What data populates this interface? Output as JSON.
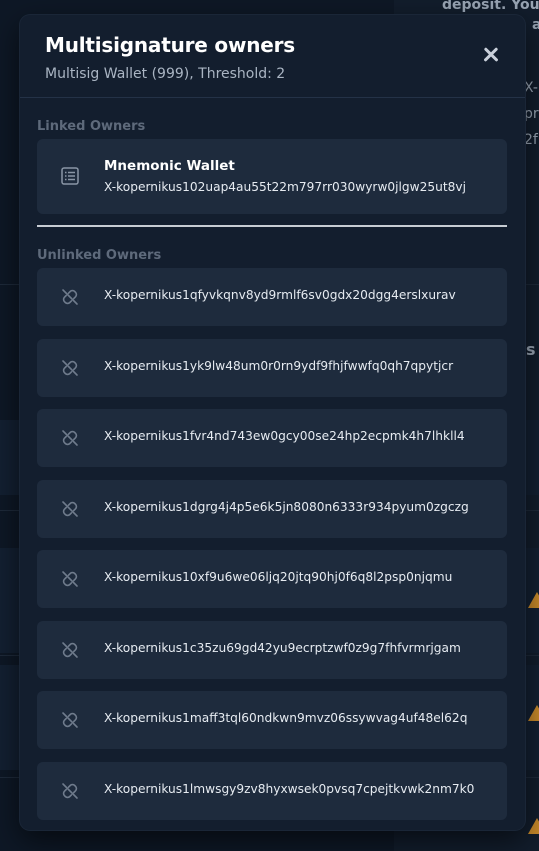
{
  "background": {
    "snippet_top_1": "deposit. You c",
    "snippet_top_2": "a",
    "snippet_right_1": "X-I",
    "snippet_right_2": "pr",
    "snippet_right_3": "2f",
    "snippet_right_4": "s"
  },
  "modal": {
    "title": "Multisignature owners",
    "subtitle": "Multisig Wallet (999), Threshold: 2",
    "close_icon": "close-x-icon"
  },
  "linked": {
    "section_label": "Linked Owners",
    "items": [
      {
        "icon": "wallet-list-icon",
        "name": "Mnemonic Wallet",
        "address": "X-kopernikus102uap4au55t22m797rr030wyrw0jlgw25ut8vj"
      }
    ]
  },
  "unlinked": {
    "section_label": "Unlinked Owners",
    "icon": "broken-link-icon",
    "items": [
      "X-kopernikus1qfyvkqnv8yd9rmlf6sv0gdx20dgg4erslxurav",
      "X-kopernikus1yk9lw48um0r0rn9ydf9fhjfwwfq0qh7qpytjcr",
      "X-kopernikus1fvr4nd743ew0gcy00se24hp2ecpmk4h7lhkll4",
      "X-kopernikus1dgrg4j4p5e6k5jn8080n6333r934pyum0zgczg",
      "X-kopernikus10xf9u6we06ljq20jtq90hj0f6q8l2psp0njqmu",
      "X-kopernikus1c35zu69gd42yu9ecrptzwf0z9g7fhfvrmrjgam",
      "X-kopernikus1maff3tql60ndkwn9mvz06ssywvag4uf48el62q",
      "X-kopernikus1lmwsgy9zv8hyxwsek0pvsq7cpejtkvwk2nm7k0"
    ]
  },
  "colors": {
    "modal_bg": "#131e2e",
    "card_bg": "#1e2b3d",
    "label_muted": "#5e6a7b",
    "warning": "#c98a2a"
  }
}
